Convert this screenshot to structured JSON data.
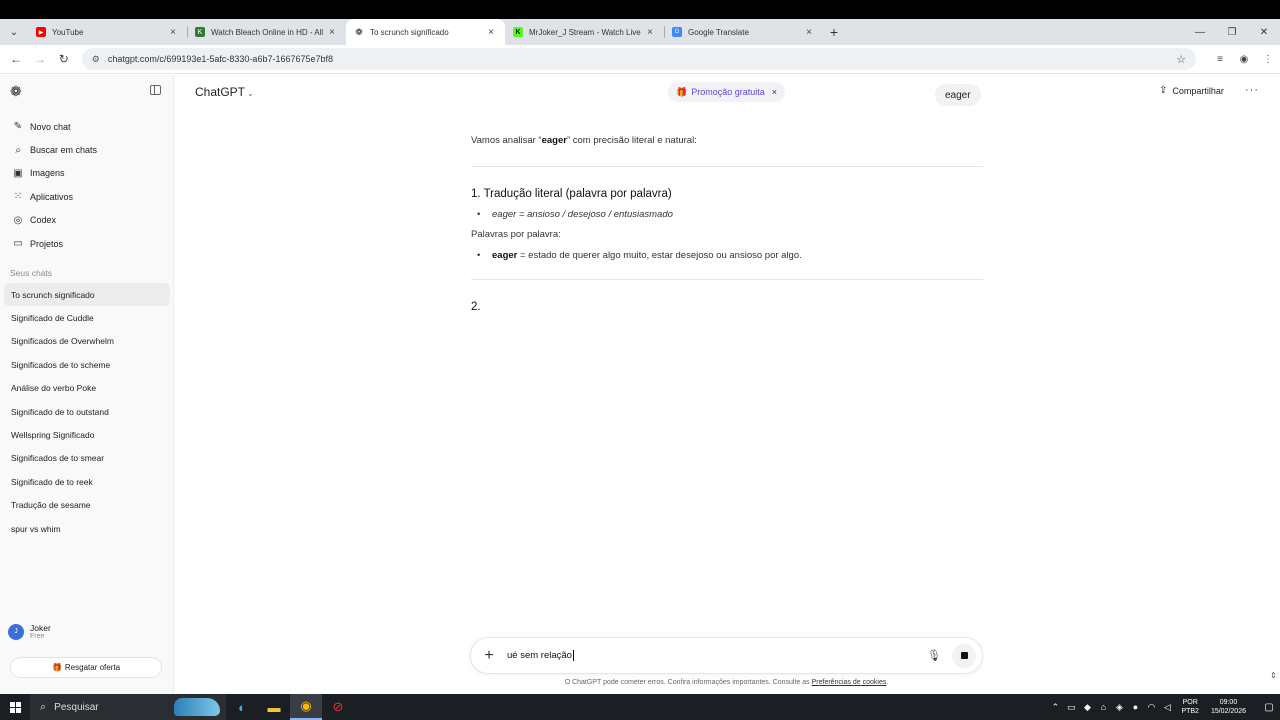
{
  "browser": {
    "tabs": [
      {
        "title": "YouTube",
        "favicon": "youtube-icon",
        "color": "#ff0000"
      },
      {
        "title": "Watch Bleach Online in HD - All",
        "favicon": "k-icon",
        "color": "#2e7d32"
      },
      {
        "title": "To scrunch significado",
        "favicon": "chatgpt-icon",
        "color": "#222222",
        "active": true
      },
      {
        "title": "MrJoker_J Stream - Watch Live",
        "favicon": "kick-icon",
        "color": "#53fc18"
      },
      {
        "title": "Google Translate",
        "favicon": "translate-icon",
        "color": "#4285f4"
      }
    ],
    "url": "chatgpt.com/c/699193e1-5afc-8330-a6b7-1667675e7bf8"
  },
  "sidebar": {
    "nav": [
      {
        "label": "Novo chat",
        "icon": "edit-icon",
        "glyph": "✎"
      },
      {
        "label": "Buscar em chats",
        "icon": "search-icon",
        "glyph": "⌕"
      },
      {
        "label": "Imagens",
        "icon": "image-icon",
        "glyph": "▣"
      },
      {
        "label": "Aplicativos",
        "icon": "apps-icon",
        "glyph": "⁙"
      },
      {
        "label": "Codex",
        "icon": "codex-icon",
        "glyph": "◎"
      },
      {
        "label": "Projetos",
        "icon": "folder-icon",
        "glyph": "▭"
      }
    ],
    "section_label": "Seus chats",
    "chats": [
      "To scrunch significado",
      "Significado de Cuddle",
      "Significados de Overwhelm",
      "Significados de to scheme",
      "Análise do verbo Poke",
      "Significado de to outstand",
      "Wellspring Significado",
      "Significados de to smear",
      "Significado de to reek",
      "Tradução de sesame",
      "spur vs whim"
    ],
    "user": {
      "initial": "J",
      "name": "Joker",
      "plan": "Free"
    },
    "offer_label": "Resgatar oferta"
  },
  "header": {
    "model": "ChatGPT",
    "promo": "Promoção gratuita",
    "share": "Compartilhar"
  },
  "user_message": "eager",
  "response": {
    "intro_pre": "Vamos analisar “",
    "intro_word": "eager",
    "intro_post": "” com precisão literal e natural:",
    "h1": "1. Tradução literal (palavra por palavra)",
    "literal": "eager = ansioso / desejoso / entusiasmado",
    "para": "Palavras por palavra:",
    "def_word": "eager",
    "def_rest": " = estado de querer algo muito, estar desejoso ou ansioso por algo.",
    "h2": "2."
  },
  "composer": {
    "value": "ué sem relação"
  },
  "disclaimer": {
    "text": "O ChatGPT pode cometer erros. Confira informações importantes. Consulte as ",
    "link": "Preferências de cookies",
    "end": "."
  },
  "taskbar": {
    "search": "Pesquisar",
    "lang1": "POR",
    "lang2": "PTB2",
    "time": "09:00",
    "date": "15/02/2026"
  }
}
